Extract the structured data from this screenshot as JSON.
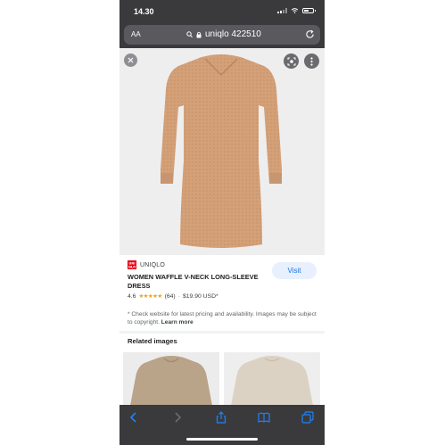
{
  "status_bar": {
    "time": "14.30"
  },
  "browser": {
    "text_size_label": "AA",
    "url_text": "uniqlo 422510"
  },
  "product": {
    "brand": "UNIQLO",
    "logo_text": "UNI QLO",
    "visit_label": "Visit",
    "title": "WOMEN WAFFLE V-NECK LONG-SLEEVE DRESS",
    "rating": "4.6",
    "stars": "★★★★★",
    "review_count": "(64)",
    "separator": "·",
    "price": "$19.90 USD*",
    "note": "* Check website for latest pricing and availability. Images may be subject to copyright.",
    "learn_more": "Learn more"
  },
  "related_heading": "Related images",
  "colors": {
    "chrome_bg": "#3a3a3c",
    "dress_tan": "#d4a078",
    "visit_bg": "#e8f0fe",
    "visit_text": "#1a73e8",
    "star": "#e8a317",
    "brand_red": "#e60012"
  },
  "icons": [
    "lock-icon",
    "search-icon",
    "reload-icon",
    "close-icon",
    "lens-icon",
    "more-vert-icon",
    "back-icon",
    "forward-icon",
    "share-icon",
    "bookmarks-icon",
    "tabs-icon"
  ]
}
